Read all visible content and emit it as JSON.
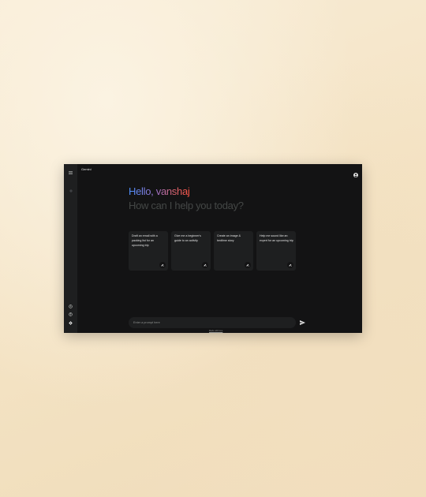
{
  "app": {
    "title": "Gemini"
  },
  "sidebar": {
    "icons": [
      "menu-icon",
      "new-chat-icon",
      "history-icon",
      "help-icon",
      "settings-icon"
    ]
  },
  "header": {
    "account_icon": "account-circle-icon"
  },
  "main": {
    "greeting": "Hello, vanshaj",
    "subgreeting": "How can I help you today?",
    "cards": [
      {
        "text": "Draft an email with a packing list for an upcoming trip",
        "icon": "edit-icon"
      },
      {
        "text": "Give me a beginner's guide to an activity",
        "icon": "edit-icon"
      },
      {
        "text": "Create an image & bedtime story",
        "icon": "edit-icon"
      },
      {
        "text": "Help me sound like an expert for an upcoming trip",
        "icon": "edit-icon"
      }
    ]
  },
  "prompt": {
    "placeholder": "Enter a prompt here",
    "value": "",
    "send_icon": "send-icon"
  },
  "footer": {
    "link_text": "Made with love"
  },
  "colors": {
    "window_bg": "#131314",
    "sidebar_bg": "#1e1f20",
    "card_bg": "#1e1f20",
    "text_primary": "#e3e3e3",
    "text_muted": "#444746",
    "gradient": [
      "#4b90ff",
      "#9b72cb",
      "#d96570",
      "#ff5546"
    ]
  }
}
